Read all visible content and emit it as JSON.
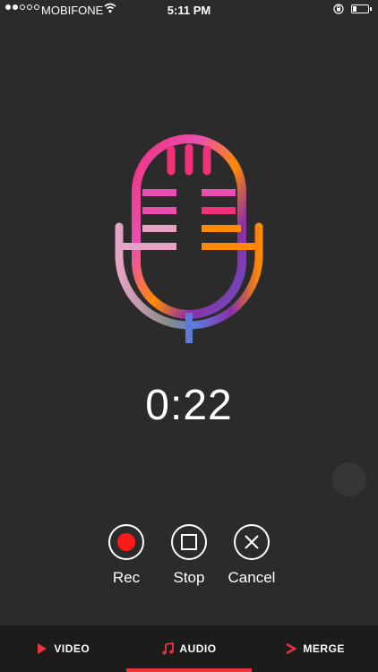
{
  "status": {
    "carrier": "MOBIFONE",
    "time": "5:11 PM",
    "signal_bars": 2,
    "signal_max": 5,
    "battery_level": 0.25
  },
  "recorder": {
    "elapsed": "0:22",
    "controls": [
      {
        "id": "rec",
        "label": "Rec",
        "icon": "record-icon"
      },
      {
        "id": "stop",
        "label": "Stop",
        "icon": "stop-icon"
      },
      {
        "id": "cancel",
        "label": "Cancel",
        "icon": "close-icon"
      }
    ]
  },
  "tabs": [
    {
      "label": "VIDEO",
      "icon": "play-icon",
      "active": false
    },
    {
      "label": "AUDIO",
      "icon": "music-note-icon",
      "active": true
    },
    {
      "label": "MERGE",
      "icon": "merge-arrow-icon",
      "active": false
    }
  ],
  "colors": {
    "background": "#2b2b2b",
    "tabbar": "#1c1c1c",
    "accent": "#e8353b",
    "record": "#ff1a1a",
    "mic_gradient": [
      "#f2317a",
      "#e94fb0",
      "#8b2fa8",
      "#ff8a00",
      "#7a6fbf",
      "#5c7bd9",
      "#8a8a8a",
      "#e6a3c4"
    ]
  }
}
